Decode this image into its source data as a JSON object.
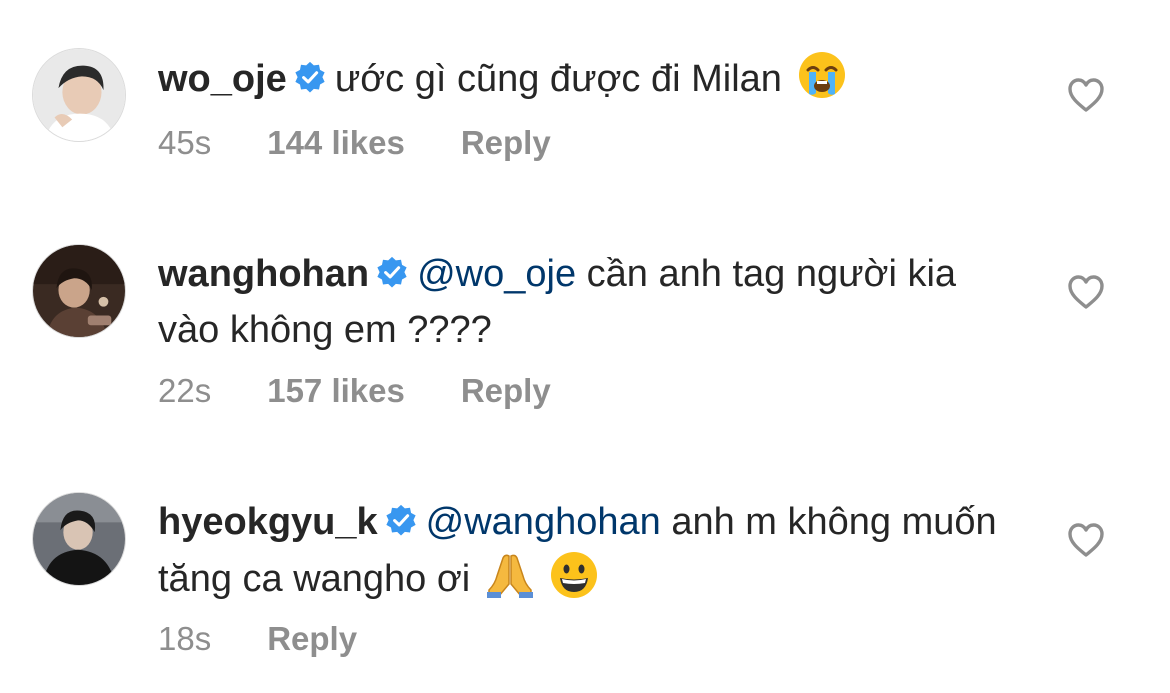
{
  "comments": [
    {
      "username": "wo_oje",
      "mention": "",
      "text": "ước gì cũng được đi Milan",
      "emoji": [
        "loudly-crying-face"
      ],
      "time": "45s",
      "likes": "144 likes",
      "reply": "Reply"
    },
    {
      "username": "wanghohan",
      "mention": "@wo_oje",
      "text": "cần anh tag người kia vào không em ????",
      "emoji": [],
      "time": "22s",
      "likes": "157 likes",
      "reply": "Reply"
    },
    {
      "username": "hyeokgyu_k",
      "mention": "@wanghohan",
      "text": "anh m không muốn tăng ca wangho ơi",
      "emoji": [
        "folded-hands",
        "grinning-face"
      ],
      "time": "18s",
      "likes": "",
      "reply": "Reply"
    }
  ],
  "colors": {
    "text": "#262626",
    "meta": "#8e8e8e",
    "mention": "#00376b",
    "verified": "#3897f0"
  }
}
